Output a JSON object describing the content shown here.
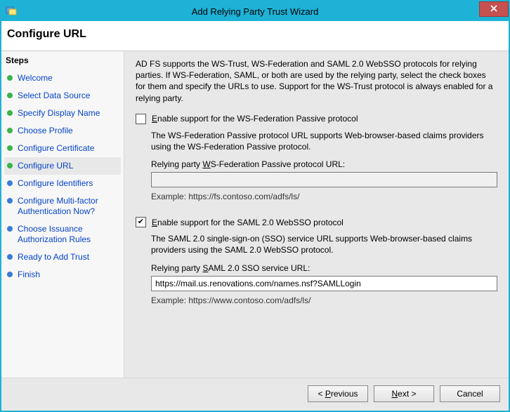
{
  "window": {
    "title": "Add Relying Party Trust Wizard"
  },
  "header": {
    "title": "Configure URL"
  },
  "steps": {
    "title": "Steps",
    "items": [
      {
        "label": "Welcome",
        "state": "done"
      },
      {
        "label": "Select Data Source",
        "state": "done"
      },
      {
        "label": "Specify Display Name",
        "state": "done"
      },
      {
        "label": "Choose Profile",
        "state": "done"
      },
      {
        "label": "Configure Certificate",
        "state": "done"
      },
      {
        "label": "Configure URL",
        "state": "done",
        "current": true
      },
      {
        "label": "Configure Identifiers",
        "state": "todo"
      },
      {
        "label": "Configure Multi-factor Authentication Now?",
        "state": "todo"
      },
      {
        "label": "Choose Issuance Authorization Rules",
        "state": "todo"
      },
      {
        "label": "Ready to Add Trust",
        "state": "todo"
      },
      {
        "label": "Finish",
        "state": "todo"
      }
    ]
  },
  "content": {
    "intro": "AD FS supports the WS-Trust, WS-Federation and SAML 2.0 WebSSO protocols for relying parties.  If WS-Federation, SAML, or both are used by the relying party, select the check boxes for them and specify the URLs to use.  Support for the WS-Trust protocol is always enabled for a relying party.",
    "wsfed": {
      "checkbox_label_pre": "",
      "checkbox_label": "Enable support for the WS-Federation Passive protocol",
      "checked": false,
      "description": "The WS-Federation Passive protocol URL supports Web-browser-based claims providers using the WS-Federation Passive protocol.",
      "url_label_pre": "Relying party ",
      "url_label_u": "W",
      "url_label_post": "S-Federation Passive protocol URL:",
      "url_value": "",
      "example": "Example: https://fs.contoso.com/adfs/ls/"
    },
    "saml": {
      "checkbox_label": "Enable support for the SAML 2.0 WebSSO protocol",
      "checked": true,
      "description": "The SAML 2.0 single-sign-on (SSO) service URL supports Web-browser-based claims providers using the SAML 2.0 WebSSO protocol.",
      "url_label_pre": "Relying party ",
      "url_label_u": "S",
      "url_label_post": "AML 2.0 SSO service URL:",
      "url_value": "https://mail.us.renovations.com/names.nsf?SAMLLogin",
      "example": "Example: https://www.contoso.com/adfs/ls/"
    }
  },
  "footer": {
    "previous": "< Previous",
    "next": "Next >",
    "cancel": "Cancel"
  }
}
